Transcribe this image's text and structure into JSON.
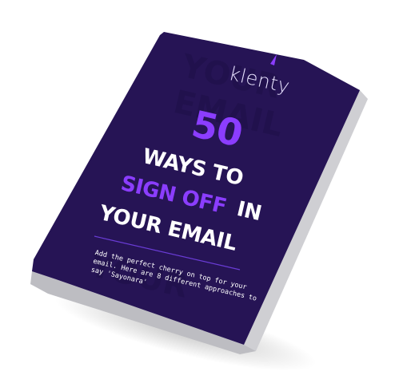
{
  "book": {
    "brand": "klenty",
    "title_number": "50",
    "title_line1": "WAYS TO",
    "title_highlight": "SIGN OFF",
    "title_line2_rest": "IN",
    "title_line3": "YOUR EMAIL",
    "description": "Add the perfect cherry on top for your email. Here are 8 different approaches to say 'Sayonara'"
  },
  "colors": {
    "cover": "#261455",
    "accent": "#8b3dff",
    "pages": "#d9d9dc"
  }
}
